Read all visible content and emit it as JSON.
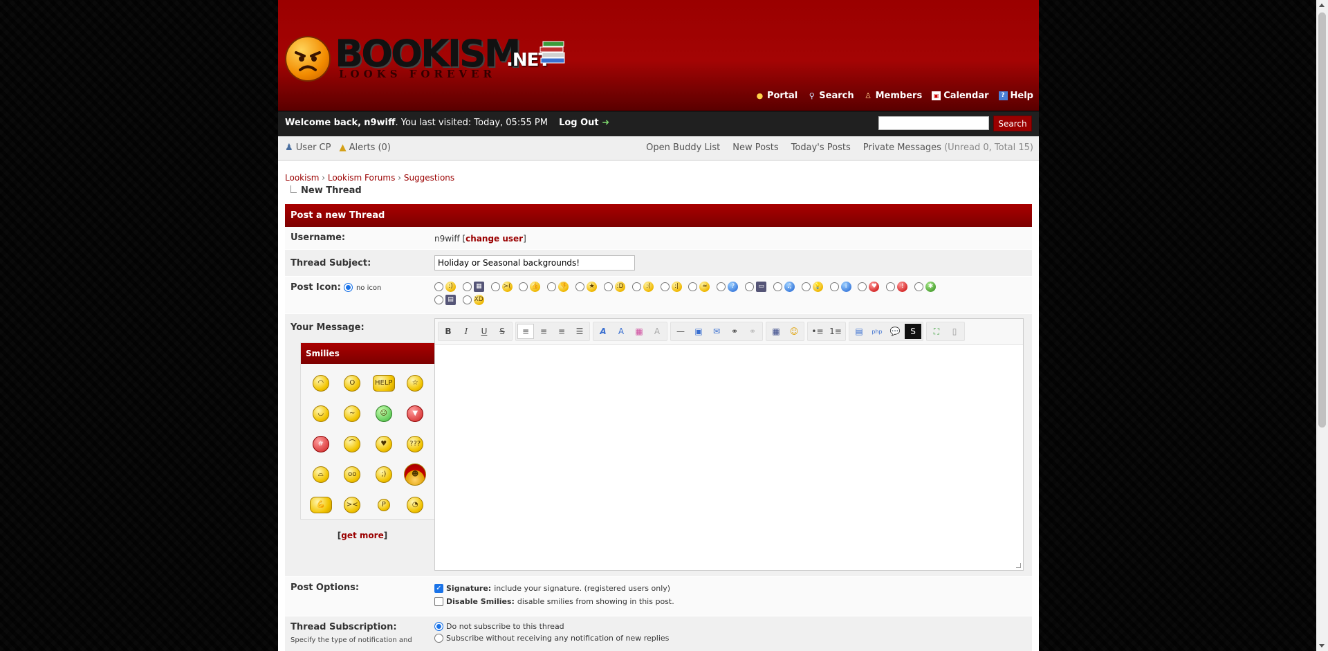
{
  "header": {
    "logo_text": "BOOKISM",
    "logo_suffix": ".NET",
    "logo_tagline": "LOOKS FOREVER",
    "toplinks": [
      "Portal",
      "Search",
      "Members",
      "Calendar",
      "Help"
    ]
  },
  "panel": {
    "welcome_prefix": "Welcome back,",
    "username": "n9wiff",
    "last_visited": ". You last visited: Today, 05:55 PM",
    "logout_label": "Log Out",
    "search_button": "Search",
    "search_value": ""
  },
  "userbar": {
    "left": [
      "User CP",
      "Alerts (0)"
    ],
    "right": [
      "Open Buddy List",
      "New Posts",
      "Today's Posts",
      "Private Messages"
    ],
    "pm_counts": "(Unread 0, Total 15)"
  },
  "breadcrumb": {
    "items": [
      "Lookism",
      "Lookism Forums",
      "Suggestions"
    ],
    "current": "New Thread"
  },
  "form": {
    "title": "Post a new Thread",
    "username_label": "Username:",
    "username_value": "n9wiff",
    "change_user": "change user",
    "subject_label": "Thread Subject:",
    "subject_value": "Holiday or Seasonal backgrounds!",
    "post_icon_label": "Post Icon:",
    "no_icon_label": "no icon",
    "message_label": "Your Message:",
    "smilies_title": "Smilies",
    "get_more": "get more",
    "post_options_label": "Post Options:",
    "signature_title": "Signature:",
    "signature_desc": "include your signature. (registered users only)",
    "disable_smilies_title": "Disable Smilies:",
    "disable_smilies_desc": "disable smilies from showing in this post.",
    "subscription_label": "Thread Subscription:",
    "subscription_desc": "Specify the type of notification and",
    "sub_opt1": "Do not subscribe to this thread",
    "sub_opt2": "Subscribe without receiving any notification of new replies"
  }
}
